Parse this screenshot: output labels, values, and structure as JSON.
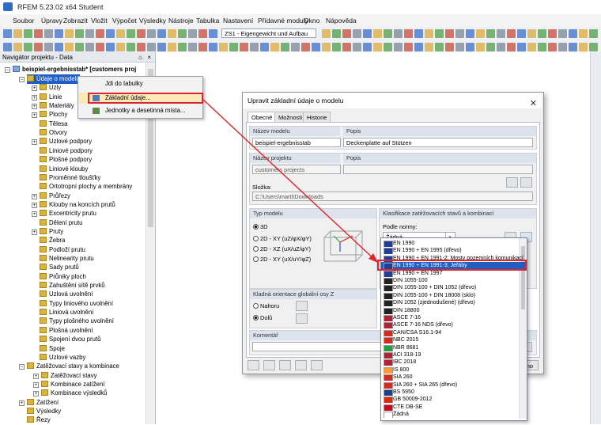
{
  "window": {
    "title": "RFEM 5.23.02 x64 Student"
  },
  "menu": [
    "Soubor",
    "Úpravy",
    "Zobrazit",
    "Vložit",
    "Výpočet",
    "Výsledky",
    "Nástroje",
    "Tabulka",
    "Nastavení",
    "Přídavné moduly",
    "Okno",
    "Nápověda"
  ],
  "toolbar": {
    "loadcase_combo": "ZS1 - Eigengewicht und Aufbau"
  },
  "navigator": {
    "title": "Navigátor projektu - Data",
    "pin": "⌂",
    "close": "×",
    "root": "beispiel-ergebnisstab* [customers proj",
    "items": [
      "Údaje o modelu",
      "Uzly",
      "Linie",
      "Materiály",
      "Plochy",
      "Tělesa",
      "Otvory",
      "Uzlové podpory",
      "Liniové podpory",
      "Plošné podpory",
      "Liniové klouby",
      "Proměnné tloušťky",
      "Ortotropní plochy a membrány",
      "Průřezy",
      "Klouby na koncích prutů",
      "Excentricity prutu",
      "Dělení prutu",
      "Pruty",
      "Žebra",
      "Podloží prutu",
      "Nelinearity prutu",
      "Sady prutů",
      "Průniky ploch",
      "Zahuštění sítě prvků",
      "Uzlová uvolnění",
      "Typy liniového uvolnění",
      "Liniová uvolnění",
      "Typy plošného uvolnění",
      "Plošná uvolnění",
      "Spojení dvou prutů",
      "Spoje",
      "Uzlové vazby",
      "Zatěžovací stavy a kombinace",
      "Zatěžovací stavy",
      "Kombinace zatížení",
      "Kombinace výsledků",
      "Zatížení",
      "Výsledky",
      "Řezy"
    ]
  },
  "context_menu": {
    "items": [
      "Jdi do tabulky",
      "Základní údaje...",
      "Jednotky a desetinná místa..."
    ]
  },
  "dialog": {
    "title": "Upravit základní údaje o modelu",
    "close": "✕",
    "tabs": [
      "Obecné",
      "Možnosti",
      "Historie"
    ],
    "model_name_label": "Název modelu",
    "model_name": "beispiel-ergebnisstab",
    "description_label": "Popis",
    "description": "Deckenplatte auf Stützen",
    "project_name_label": "Název projektu",
    "project_name": "customers projects",
    "project_desc_label": "Popis",
    "project_desc": "",
    "folder_label": "Složka:",
    "folder": "C:\\Users\\marti\\Downloads",
    "model_type_label": "Typ modelu",
    "model_types": [
      "3D",
      "2D - XY (uZ/φX/φY)",
      "2D - XZ (uX/uZ/φY)",
      "2D - XY (uX/uY/φZ)"
    ],
    "classification_label": "Klasifikace zatěžovacích stavů a kombinací",
    "norm_label": "Podle normy:",
    "norm_value": "Žádná",
    "orientation_label": "Kladná orientace globální osy Z",
    "orientation_options": [
      "Nahoru",
      "Dolů"
    ],
    "comment_label": "Komentář",
    "ok_partial": "mo"
  },
  "norm_dropdown": {
    "items": [
      "EN 1990",
      "EN 1990 + EN 1995 (dřevo)",
      "EN 1990 + EN 1991-2; Mosty pozemních komunikací",
      "EN 1990 + EN 1991-3; Jeřáby",
      "EN 1990 + EN 1997",
      "DIN 1055-100",
      "DIN 1055-100 + DIN 1052 (dřevo)",
      "DIN 1055-100 + DIN 18008 (sklo)",
      "DIN 1052 (zjednodušené) (dřevo)",
      "DIN 18800",
      "ASCE 7-16",
      "ASCE 7-16 NDS (dřevo)",
      "CAN/CSA S16.1-94",
      "NBC 2015",
      "NBR 8681",
      "ACI 318-19",
      "IBC 2018",
      "IS 800",
      "SIA 260",
      "SIA 260 + SIA 265 (dřevo)",
      "BS 5950",
      "GB 50009-2012",
      "CTE DB-SE",
      "Žádná"
    ],
    "selected_index": 3,
    "flag_colors": [
      "#1f3f99",
      "#1f3f99",
      "#1f3f99",
      "#1f3f99",
      "#1f3f99",
      "#222222",
      "#222222",
      "#222222",
      "#222222",
      "#222222",
      "#b22234",
      "#b22234",
      "#d52b1e",
      "#d52b1e",
      "#229e45",
      "#b22234",
      "#b22234",
      "#ff9933",
      "#d52b1e",
      "#d52b1e",
      "#1d3d8f",
      "#de2910",
      "#c60b1e",
      "#ffffff"
    ]
  },
  "colors": {
    "highlight_red": "#e0262c",
    "selection_blue": "#1e5fc4",
    "arrow_red": "#e0262c"
  }
}
